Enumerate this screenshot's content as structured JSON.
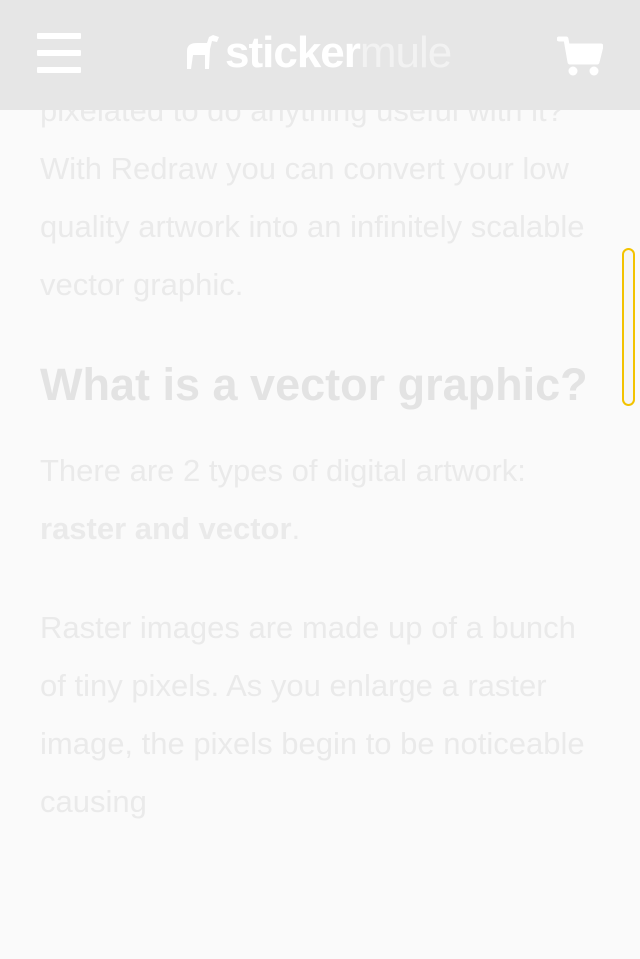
{
  "header": {
    "logo_part1": "sticker",
    "logo_part2": "mule"
  },
  "article": {
    "intro": "pixelated to do anything useful with it? With Redraw you can convert your low quality artwork into an infinitely scalable vector graphic.",
    "heading": "What is a vector graphic?",
    "p2_prefix": "There are 2 types of digital artwork: ",
    "p2_bold": "raster and vector",
    "p2_suffix": ".",
    "p3": "Raster images are made up of a bunch of tiny pixels. As you enlarge a raster image, the pixels begin to be noticeable causing"
  },
  "colors": {
    "header_bg": "#e6e6e6",
    "page_bg": "#fafafa",
    "scrollbar_border": "#f3c300"
  }
}
